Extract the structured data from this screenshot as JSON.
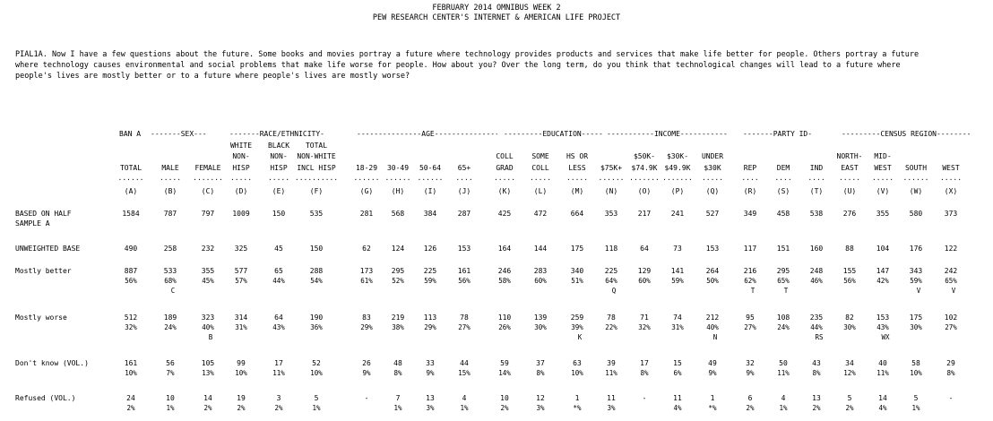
{
  "header": {
    "line1": "FEBRUARY 2014 OMNIBUS WEEK 2",
    "line2": "PEW RESEARCH CENTER'S INTERNET & AMERICAN LIFE PROJECT"
  },
  "question": "PIAL1A. Now I have a few questions about the future. Some books and movies portray a future where technology provides products and services that make life better for people. Others portray a future\nwhere technology causes environmental and social problems that make life worse for people. How about you? Over the long term, do you think that technological changes will lead to a future where\npeople's lives are mostly better or to a future where people's lives are mostly worse?",
  "banner": "BAN A",
  "groups": [
    {
      "label": "-------SEX-------"
    },
    {
      "label": "-------RACE/ETHNICITY-------"
    },
    {
      "label": "---------------AGE---------------"
    },
    {
      "label": "---------EDUCATION---------"
    },
    {
      "label": "-----------INCOME-----------"
    },
    {
      "label": "-------PARTY ID-------"
    },
    {
      "label": "---------CENSUS REGION---------"
    }
  ],
  "columns": [
    {
      "l1": "",
      "l2": "",
      "l3": "TOTAL",
      "letter": "(A)"
    },
    {
      "l1": "",
      "l2": "",
      "l3": "MALE",
      "letter": "(B)"
    },
    {
      "l1": "",
      "l2": "",
      "l3": "FEMALE",
      "letter": "(C)"
    },
    {
      "l1": "WHITE",
      "l2": "NON-",
      "l3": "HISP",
      "letter": "(D)"
    },
    {
      "l1": "BLACK",
      "l2": "NON-",
      "l3": "HISP",
      "letter": "(E)"
    },
    {
      "l1": "TOTAL",
      "l2": "NON-WHITE",
      "l3": "INCL HISP",
      "letter": "(F)"
    },
    {
      "l1": "",
      "l2": "",
      "l3": "18-29",
      "letter": "(G)"
    },
    {
      "l1": "",
      "l2": "",
      "l3": "30-49",
      "letter": "(H)"
    },
    {
      "l1": "",
      "l2": "",
      "l3": "50-64",
      "letter": "(I)"
    },
    {
      "l1": "",
      "l2": "",
      "l3": "65+",
      "letter": "(J)"
    },
    {
      "l1": "",
      "l2": "COLL",
      "l3": "GRAD",
      "letter": "(K)"
    },
    {
      "l1": "",
      "l2": "SOME",
      "l3": "COLL",
      "letter": "(L)"
    },
    {
      "l1": "",
      "l2": "HS OR",
      "l3": "LESS",
      "letter": "(M)"
    },
    {
      "l1": "",
      "l2": "",
      "l3": "$75K+",
      "letter": "(N)"
    },
    {
      "l1": "",
      "l2": "$50K-",
      "l3": "$74.9K",
      "letter": "(O)"
    },
    {
      "l1": "",
      "l2": "$30K-",
      "l3": "$49.9K",
      "letter": "(P)"
    },
    {
      "l1": "",
      "l2": "UNDER",
      "l3": "$30K",
      "letter": "(Q)"
    },
    {
      "l1": "",
      "l2": "",
      "l3": "REP",
      "letter": "(R)"
    },
    {
      "l1": "",
      "l2": "",
      "l3": "DEM",
      "letter": "(S)"
    },
    {
      "l1": "",
      "l2": "",
      "l3": "IND",
      "letter": "(T)"
    },
    {
      "l1": "",
      "l2": "NORTH-",
      "l3": "EAST",
      "letter": "(U)"
    },
    {
      "l1": "",
      "l2": "MID-",
      "l3": "WEST",
      "letter": "(V)"
    },
    {
      "l1": "",
      "l2": "",
      "l3": "SOUTH",
      "letter": "(W)"
    },
    {
      "l1": "",
      "l2": "",
      "l3": "WEST",
      "letter": "(X)"
    }
  ],
  "rows": [
    {
      "label": "BASED ON HALF",
      "label2": "SAMPLE A",
      "n": [
        "1584",
        "787",
        "797",
        "1009",
        "150",
        "535",
        "281",
        "568",
        "384",
        "287",
        "425",
        "472",
        "664",
        "353",
        "217",
        "241",
        "527",
        "349",
        "458",
        "538",
        "276",
        "355",
        "580",
        "373"
      ]
    },
    {
      "label": "UNWEIGHTED BASE",
      "n": [
        "490",
        "258",
        "232",
        "325",
        "45",
        "150",
        "62",
        "124",
        "126",
        "153",
        "164",
        "144",
        "175",
        "118",
        "64",
        "73",
        "153",
        "117",
        "151",
        "160",
        "88",
        "104",
        "176",
        "122"
      ]
    },
    {
      "label": "Mostly better",
      "n": [
        "887",
        "533",
        "355",
        "577",
        "65",
        "288",
        "173",
        "295",
        "225",
        "161",
        "246",
        "283",
        "340",
        "225",
        "129",
        "141",
        "264",
        "216",
        "295",
        "248",
        "155",
        "147",
        "343",
        "242"
      ],
      "p": [
        "56%",
        "68%",
        "45%",
        "57%",
        "44%",
        "54%",
        "61%",
        "52%",
        "59%",
        "56%",
        "58%",
        "60%",
        "51%",
        "64%",
        "60%",
        "59%",
        "50%",
        "62%",
        "65%",
        "46%",
        "56%",
        "42%",
        "59%",
        "65%"
      ],
      "s": [
        "",
        "C",
        "",
        "",
        "",
        "",
        "",
        "",
        "",
        "",
        "",
        "",
        "",
        "Q",
        "",
        "",
        "",
        "T",
        "T",
        "",
        "",
        "",
        "V",
        "V"
      ]
    },
    {
      "label": "Mostly worse",
      "n": [
        "512",
        "189",
        "323",
        "314",
        "64",
        "190",
        "83",
        "219",
        "113",
        "78",
        "110",
        "139",
        "259",
        "78",
        "71",
        "74",
        "212",
        "95",
        "108",
        "235",
        "82",
        "153",
        "175",
        "102"
      ],
      "p": [
        "32%",
        "24%",
        "40%",
        "31%",
        "43%",
        "36%",
        "29%",
        "38%",
        "29%",
        "27%",
        "26%",
        "30%",
        "39%",
        "22%",
        "32%",
        "31%",
        "40%",
        "27%",
        "24%",
        "44%",
        "30%",
        "43%",
        "30%",
        "27%"
      ],
      "s": [
        "",
        "",
        "B",
        "",
        "",
        "",
        "",
        "",
        "",
        "",
        "",
        "",
        "K",
        "",
        "",
        "",
        "N",
        "",
        "",
        "RS",
        "",
        "WX",
        "",
        ""
      ]
    },
    {
      "label": "Don't know (VOL.)",
      "n": [
        "161",
        "56",
        "105",
        "99",
        "17",
        "52",
        "26",
        "48",
        "33",
        "44",
        "59",
        "37",
        "63",
        "39",
        "17",
        "15",
        "49",
        "32",
        "50",
        "43",
        "34",
        "40",
        "58",
        "29"
      ],
      "p": [
        "10%",
        "7%",
        "13%",
        "10%",
        "11%",
        "10%",
        "9%",
        "8%",
        "9%",
        "15%",
        "14%",
        "8%",
        "10%",
        "11%",
        "8%",
        "6%",
        "9%",
        "9%",
        "11%",
        "8%",
        "12%",
        "11%",
        "10%",
        "8%"
      ],
      "s": []
    },
    {
      "label": "Refused (VOL.)",
      "n": [
        "24",
        "10",
        "14",
        "19",
        "3",
        "5",
        "-",
        "7",
        "13",
        "4",
        "10",
        "12",
        "1",
        "11",
        "-",
        "11",
        "1",
        "6",
        "4",
        "13",
        "5",
        "14",
        "5",
        "-"
      ],
      "p": [
        "2%",
        "1%",
        "2%",
        "2%",
        "2%",
        "1%",
        "",
        "1%",
        "3%",
        "1%",
        "2%",
        "3%",
        "*%",
        "3%",
        "",
        "4%",
        "*%",
        "2%",
        "1%",
        "2%",
        "2%",
        "4%",
        "1%",
        ""
      ],
      "s": []
    }
  ]
}
